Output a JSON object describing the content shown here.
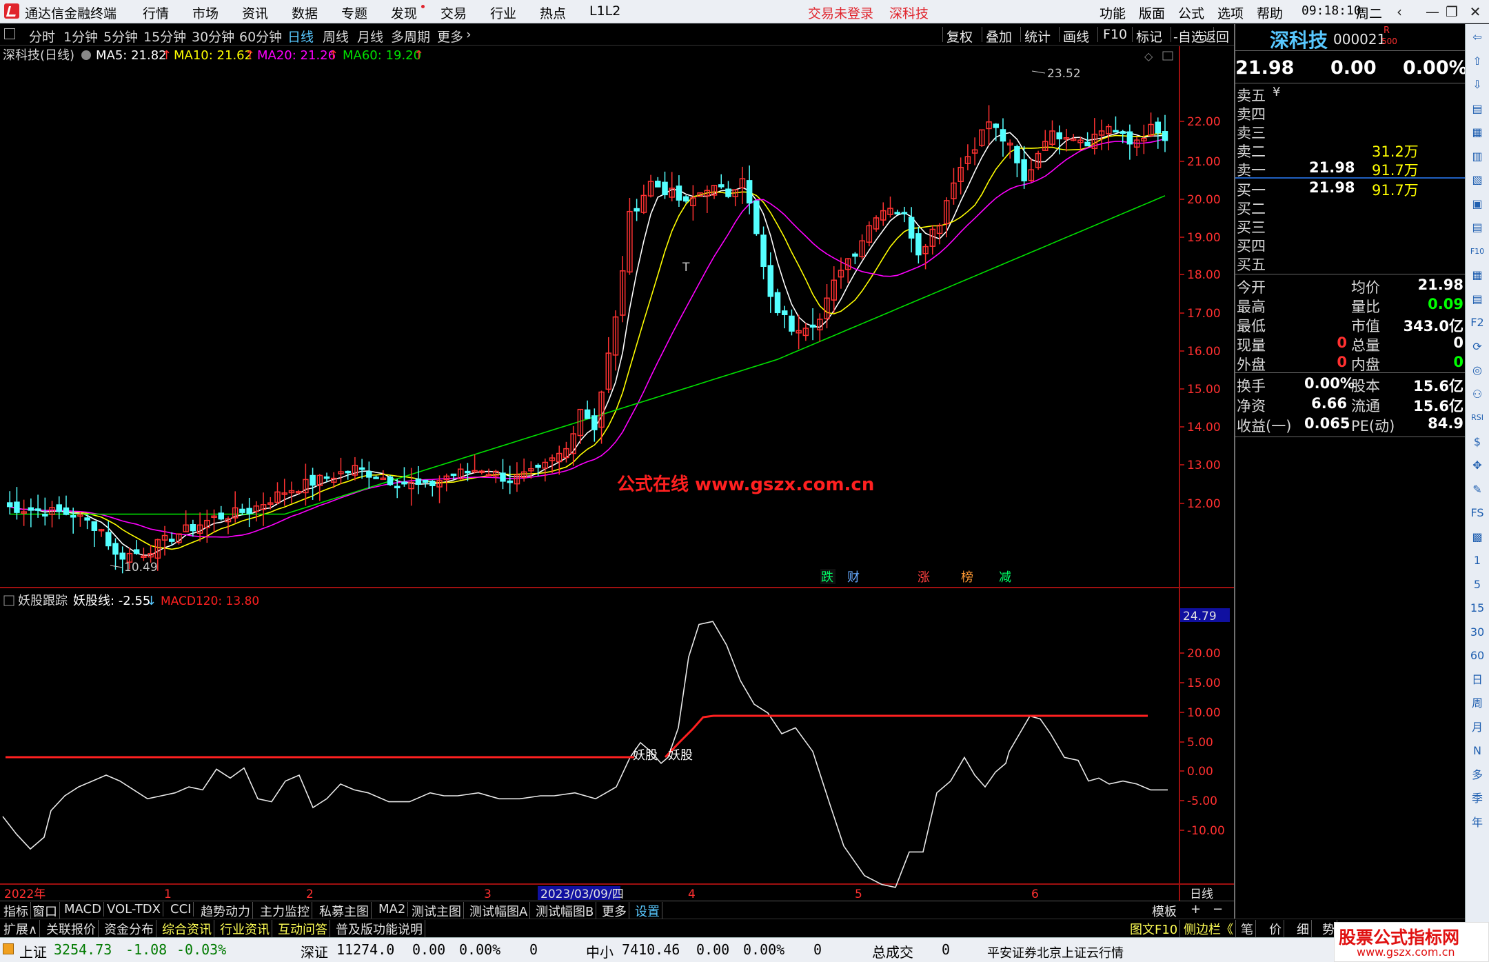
{
  "menubar": {
    "app_title": "通达信金融终端",
    "items": [
      "行情",
      "市场",
      "资讯",
      "数据",
      "专题",
      "发现",
      "交易",
      "行业",
      "热点",
      "L1L2"
    ],
    "login_status": "交易未登录",
    "stock_name": "深科技",
    "right_items": [
      "功能",
      "版面",
      "公式",
      "选项",
      "帮助"
    ],
    "clock": "09:18:10",
    "weekday": "周二",
    "window_buttons": [
      "‹",
      "—",
      "❐",
      "✕"
    ]
  },
  "toolbar": {
    "periods": [
      "分时",
      "1分钟",
      "5分钟",
      "15分钟",
      "30分钟",
      "60分钟",
      "日线",
      "周线",
      "月线",
      "多周期",
      "更多"
    ],
    "active_period": "日线",
    "right_buttons": [
      "复权",
      "叠加",
      "统计",
      "画线",
      "F10",
      "标记",
      "-自选",
      "返回"
    ]
  },
  "main_chart": {
    "title": "深科技(日线)",
    "ma": [
      {
        "label": "MA5: 21.82",
        "color": "#ffffff"
      },
      {
        "label": "MA10: 21.62",
        "color": "#ffff00"
      },
      {
        "label": "MA20: 21.26",
        "color": "#ff00ff"
      },
      {
        "label": "MA60: 19.20",
        "color": "#00e000"
      }
    ],
    "price_axis": [
      "22.00",
      "21.00",
      "20.00",
      "19.00",
      "18.00",
      "17.00",
      "16.00",
      "15.00",
      "14.00",
      "13.00",
      "12.00"
    ],
    "high_label": "23.52",
    "low_label": "10.49",
    "t_marker": "T",
    "watermark": "公式在线  www.gszx.com.cn",
    "event_tags": [
      {
        "label": "跌",
        "color": "#00ff66"
      },
      {
        "label": "财",
        "color": "#66aaff"
      },
      {
        "label": "涨",
        "color": "#ff4040"
      },
      {
        "label": "榜",
        "color": "#ff9933"
      },
      {
        "label": "减",
        "color": "#00ff66"
      }
    ]
  },
  "sub_chart": {
    "title": "妖股跟踪",
    "line_label": "妖股线: -2.55",
    "macd_label": "MACD120: 13.80",
    "axis": [
      "20.00",
      "15.00",
      "10.00",
      "5.00",
      "0.00",
      "-5.00",
      "-10.00"
    ],
    "top_value": "24.79",
    "signal_label": "妖股",
    "date_axis": [
      "2022年",
      "1",
      "2",
      "2023/03/09/四",
      "3",
      "4",
      "5",
      "6"
    ],
    "period_label": "日线"
  },
  "quote": {
    "name": "深科技",
    "code": "000021",
    "badge_r": "R",
    "badge_num": "500",
    "price": "21.98",
    "change": "0.00",
    "change_pct": "0.00%",
    "asks": [
      {
        "label": "卖五",
        "price": "",
        "vol": "",
        "mark": "¥"
      },
      {
        "label": "卖四",
        "price": "",
        "vol": "",
        "mark": ""
      },
      {
        "label": "卖三",
        "price": "",
        "vol": "",
        "mark": ""
      },
      {
        "label": "卖二",
        "price": "",
        "vol": "31.2万",
        "mark": ""
      },
      {
        "label": "卖一",
        "price": "21.98",
        "vol": "91.7万",
        "mark": ""
      }
    ],
    "bids": [
      {
        "label": "买一",
        "price": "21.98",
        "vol": "91.7万"
      },
      {
        "label": "买二",
        "price": "",
        "vol": ""
      },
      {
        "label": "买三",
        "price": "",
        "vol": ""
      },
      {
        "label": "买四",
        "price": "",
        "vol": ""
      },
      {
        "label": "买五",
        "price": "",
        "vol": ""
      }
    ],
    "stats1": [
      {
        "l1": "今开",
        "v1": "",
        "l2": "均价",
        "v2": "21.98",
        "c2": "#ffffff"
      },
      {
        "l1": "最高",
        "v1": "",
        "l2": "量比",
        "v2": "0.09",
        "c2": "#00ff00"
      },
      {
        "l1": "最低",
        "v1": "",
        "l2": "市值",
        "v2": "343.0亿",
        "c2": "#ffffff"
      },
      {
        "l1": "现量",
        "v1": "0",
        "l2": "总量",
        "v2": "0",
        "c1": "#ff3030",
        "c2": "#ffffff"
      },
      {
        "l1": "外盘",
        "v1": "0",
        "l2": "内盘",
        "v2": "0",
        "c1": "#ff3030",
        "c2": "#00ff00"
      }
    ],
    "stats2": [
      {
        "l1": "换手",
        "v1": "0.00%",
        "l2": "股本",
        "v2": "15.6亿"
      },
      {
        "l1": "净资",
        "v1": "6.66",
        "l2": "流通",
        "v2": "15.6亿"
      },
      {
        "l1": "收益(一)",
        "v1": "0.065",
        "l2": "PE(动)",
        "v2": "84.9"
      }
    ]
  },
  "iconbar": [
    "⇦",
    "⇧",
    "⇩",
    "▤",
    "▦",
    "▥",
    "▧",
    "▣",
    "▤",
    "F10",
    "▦",
    "▤",
    "F2",
    "⟳",
    "◎",
    "⚇",
    "RSI",
    "$",
    "✥",
    "✎",
    "FS",
    "▩",
    "1",
    "5",
    "15",
    "30",
    "60",
    "日",
    "周",
    "月",
    "N",
    "多",
    "季",
    "年"
  ],
  "tabs1": [
    "指标",
    "窗口",
    "MACD",
    "VOL-TDX",
    "CCI",
    "趋势动力",
    "主力监控",
    "私募主图",
    "MA2",
    "测试主图",
    "测试幅图A",
    "测试幅图B",
    "更多",
    "设置"
  ],
  "tabs1_selected": "设置",
  "tabs1_right": [
    "模板",
    "+",
    "−"
  ],
  "tabs2": [
    "扩展∧",
    "关联报价",
    "资金分布",
    "综合资讯",
    "行业资讯",
    "互动问答",
    "普及版功能说明"
  ],
  "tabs2_yellow": [
    "综合资讯",
    "行业资讯",
    "互动问答"
  ],
  "tabs2_right": [
    "图文F10",
    "侧边栏《",
    "笔",
    "价",
    "细",
    "势"
  ],
  "status": {
    "sh_name": "上证",
    "sh_val": "3254.73",
    "sh_chg": "-1.08",
    "sh_pct": "-0.03%",
    "sz_name": "深证",
    "sz_val": "11274.0",
    "sz_chg": "0.00",
    "sz_pct": "0.00%",
    "sz_vol": "0",
    "zx_name": "中小",
    "zx_val": "7410.46",
    "zx_chg": "0.00",
    "zx_pct": "0.00%",
    "zx_vol": "0",
    "total_name": "总成交",
    "total_val": "0",
    "server": "平安证券北京上证云行情",
    "brand": "股票公式指标网",
    "brand_url": "www.gszx.com.cn"
  },
  "colors": {
    "up": "#ff3232",
    "down": "#54ffff",
    "ma5": "#ffffff",
    "ma10": "#ffff00",
    "ma20": "#ff00ff",
    "ma60": "#00e000",
    "signal": "#ff2020"
  }
}
